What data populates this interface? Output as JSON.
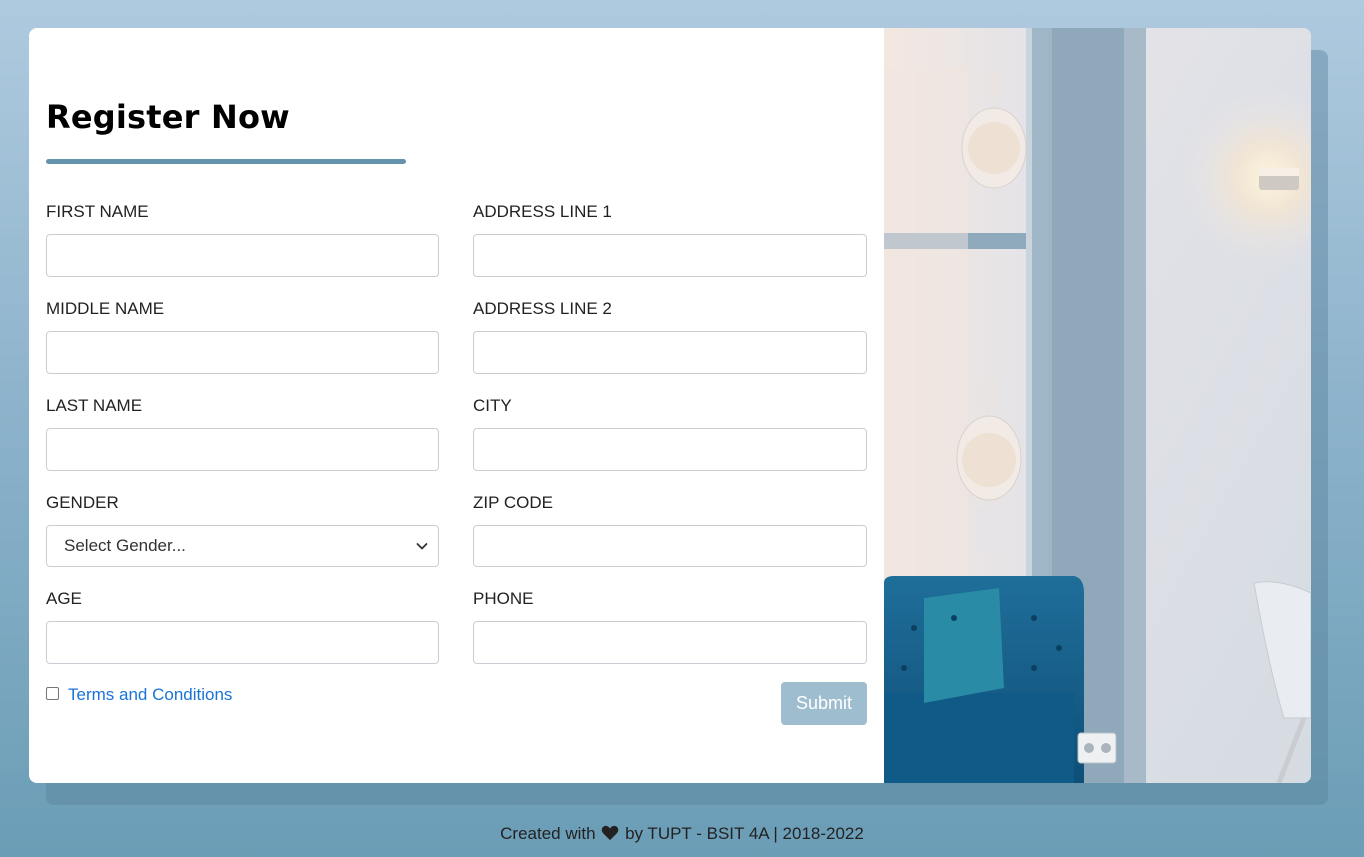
{
  "form": {
    "title": "Register Now",
    "left_fields": [
      {
        "label": "FIRST NAME",
        "value": ""
      },
      {
        "label": "MIDDLE NAME",
        "value": ""
      },
      {
        "label": "LAST NAME",
        "value": ""
      },
      {
        "label": "GENDER",
        "value": "Select Gender..."
      },
      {
        "label": "AGE",
        "value": ""
      }
    ],
    "right_fields": [
      {
        "label": "ADDRESS LINE 1",
        "value": ""
      },
      {
        "label": "ADDRESS LINE 2",
        "value": ""
      },
      {
        "label": "CITY",
        "value": ""
      },
      {
        "label": "ZIP CODE",
        "value": ""
      },
      {
        "label": "PHONE",
        "value": ""
      }
    ],
    "terms_label": "Terms and Conditions",
    "terms_checked": false,
    "submit_label": "Submit"
  },
  "footer": {
    "prefix": "Created with",
    "icon": "heart-icon",
    "suffix": "by TUPT - BSIT 4A | 2018-2022"
  },
  "colors": {
    "accent": "#6393ad",
    "submit": "#9ebed0",
    "link": "#1a73d6"
  }
}
